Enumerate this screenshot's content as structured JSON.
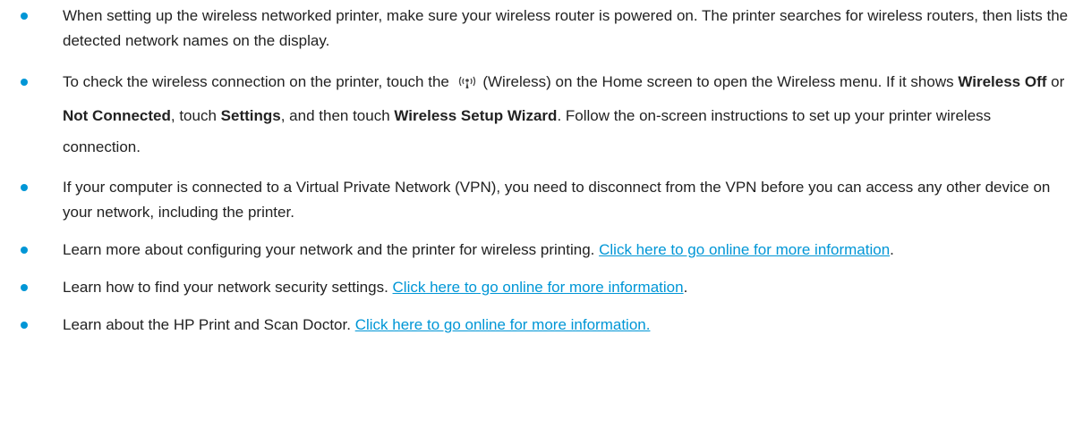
{
  "tips": [
    {
      "text": "When setting up the wireless networked printer, make sure your wireless router is powered on. The printer searches for wireless routers, then lists the detected network names on the display."
    },
    {
      "before_icon": "To check the wireless connection on the printer, touch the",
      "icon": "wireless-icon",
      "after_icon": "(Wireless) on the Home screen to open the Wireless menu. If it shows",
      "bold_1": "Wireless Off",
      "or": "or",
      "bold_2": "Not Connected",
      "touch": ", touch",
      "bold_3": "Settings",
      "then_touch": ", and then touch",
      "bold_4": "Wireless Setup Wizard",
      "follow": ". Follow the on-screen instructions to set up your printer wireless connection."
    },
    {
      "text": "If your computer is connected to a Virtual Private Network (VPN), you need to disconnect from the VPN before you can access any other device on your network, including the printer."
    },
    {
      "text": "Learn more about configuring your network and the printer for wireless printing.",
      "link": "Click here to go online for more information",
      "trail": "."
    },
    {
      "text": "Learn how to find your network security settings.",
      "link": "Click here to go online for more information",
      "trail": "."
    },
    {
      "text": "Learn about the HP Print and Scan Doctor.",
      "link": "Click here to go online for more information.",
      "trail": ""
    }
  ],
  "colors": {
    "accent": "#0096d6",
    "text": "#222222"
  }
}
